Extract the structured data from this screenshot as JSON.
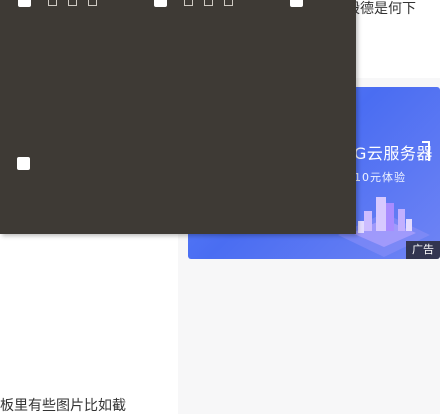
{
  "article": {
    "top_text": "殷德是何下",
    "bottom_text": "板里有些图片比如截"
  },
  "ad": {
    "title": "G云服务器",
    "subtitle": "10元体验",
    "tag": "广告",
    "colors": {
      "start": "#5d86ff",
      "end": "#6f84f4"
    }
  },
  "overlay": {
    "background": "#3e3a35",
    "checkboxes": [
      {
        "checked": false
      },
      {
        "checked": false
      },
      {
        "checked": false
      },
      {
        "checked": false
      }
    ],
    "icons": [
      "folder-icon",
      "folder-icon",
      "folder-icon",
      "folder-icon",
      "folder-icon",
      "folder-icon"
    ]
  }
}
